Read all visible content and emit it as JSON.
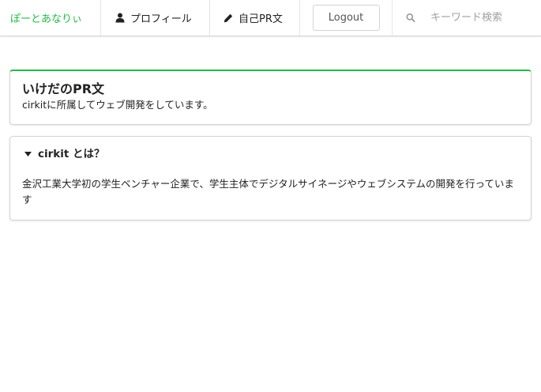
{
  "nav": {
    "brand": "ぽーとあなりぃ",
    "profile_label": "プロフィール",
    "profile_icon": "user-icon",
    "pr_label": "自己PR文",
    "pr_icon": "pencil-icon",
    "logout_label": "Logout",
    "search_icon": "search-icon",
    "search_placeholder": "キーワード検索",
    "search_value": ""
  },
  "colors": {
    "accent": "#21ba45",
    "border": "#d4d4d5"
  },
  "pr_card": {
    "title": "いけだのPR文",
    "description": "cirkitに所属してウェブ開発をしています。"
  },
  "about_card": {
    "caret_icon": "caret-down-icon",
    "title": "cirkit とは？",
    "body": "金沢工業大学初の学生ベンチャー企業で、学生主体でデジタルサイネージやウェブシステムの開発を行っています"
  }
}
